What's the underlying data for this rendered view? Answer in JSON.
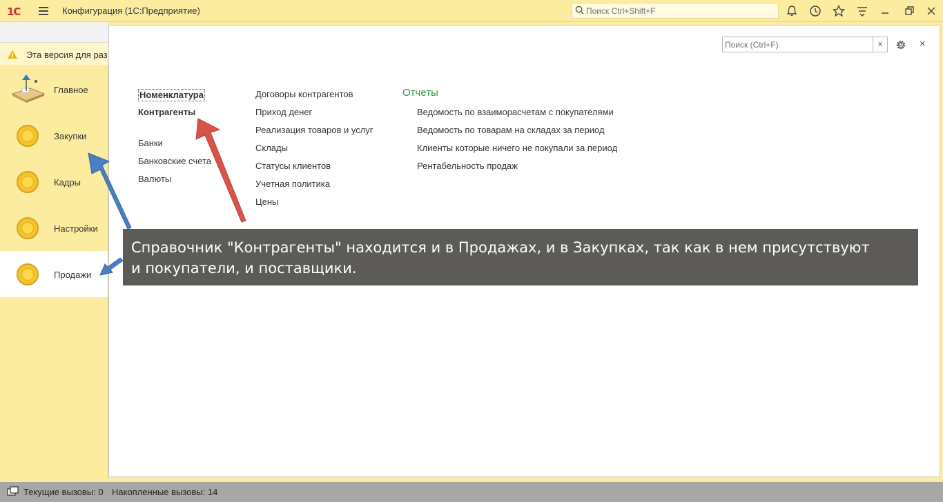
{
  "titlebar": {
    "logo": "1С",
    "app_title": "Конфигурация  (1С:Предприятие)",
    "search_placeholder": "Поиск Ctrl+Shift+F"
  },
  "warning": {
    "text": "Эта версия для раз"
  },
  "sidebar": {
    "items": [
      {
        "label": "Главное",
        "icon": "desk-lamp-icon"
      },
      {
        "label": "Закупки",
        "icon": "coin-icon"
      },
      {
        "label": "Кадры",
        "icon": "coin-icon"
      },
      {
        "label": "Настройки",
        "icon": "coin-icon"
      },
      {
        "label": "Продажи",
        "icon": "coin-icon",
        "active": true
      }
    ]
  },
  "panel": {
    "search_placeholder": "Поиск (Ctrl+F)",
    "clear_label": "×",
    "close_label": "×",
    "col1": {
      "bold": [
        "Номенклатура",
        "Контрагенты"
      ],
      "regular": [
        "Банки",
        "Банковские счета",
        "Валюты"
      ]
    },
    "col2": [
      "Договоры контрагентов",
      "Приход денег",
      "Реализация товаров и услуг",
      "Склады",
      "Статусы клиентов",
      "Учетная политика",
      "Цены"
    ],
    "reports": {
      "header": "Отчеты",
      "items": [
        "Ведомость по взаиморасчетам с покупателями",
        "Ведомость по товарам на складах за период",
        "Клиенты которые ничего не покупали за период",
        "Рентабельность продаж"
      ]
    }
  },
  "callout": {
    "line1": "Справочник \"Контрагенты\" находится и в Продажах, и в Закупках, так как в нем присутствуют",
    "line2": "и покупатели, и поставщики."
  },
  "statusbar": {
    "current_calls": "Текущие вызовы: 0",
    "accumulated_calls": "Накопленные вызовы: 14"
  },
  "colors": {
    "sidebar_bg": "#fbeca0",
    "reports_header": "#2aa13a",
    "callout_bg": "#5d5b58",
    "arrow_red": "#d9534a",
    "arrow_blue": "#4a7fc1"
  }
}
